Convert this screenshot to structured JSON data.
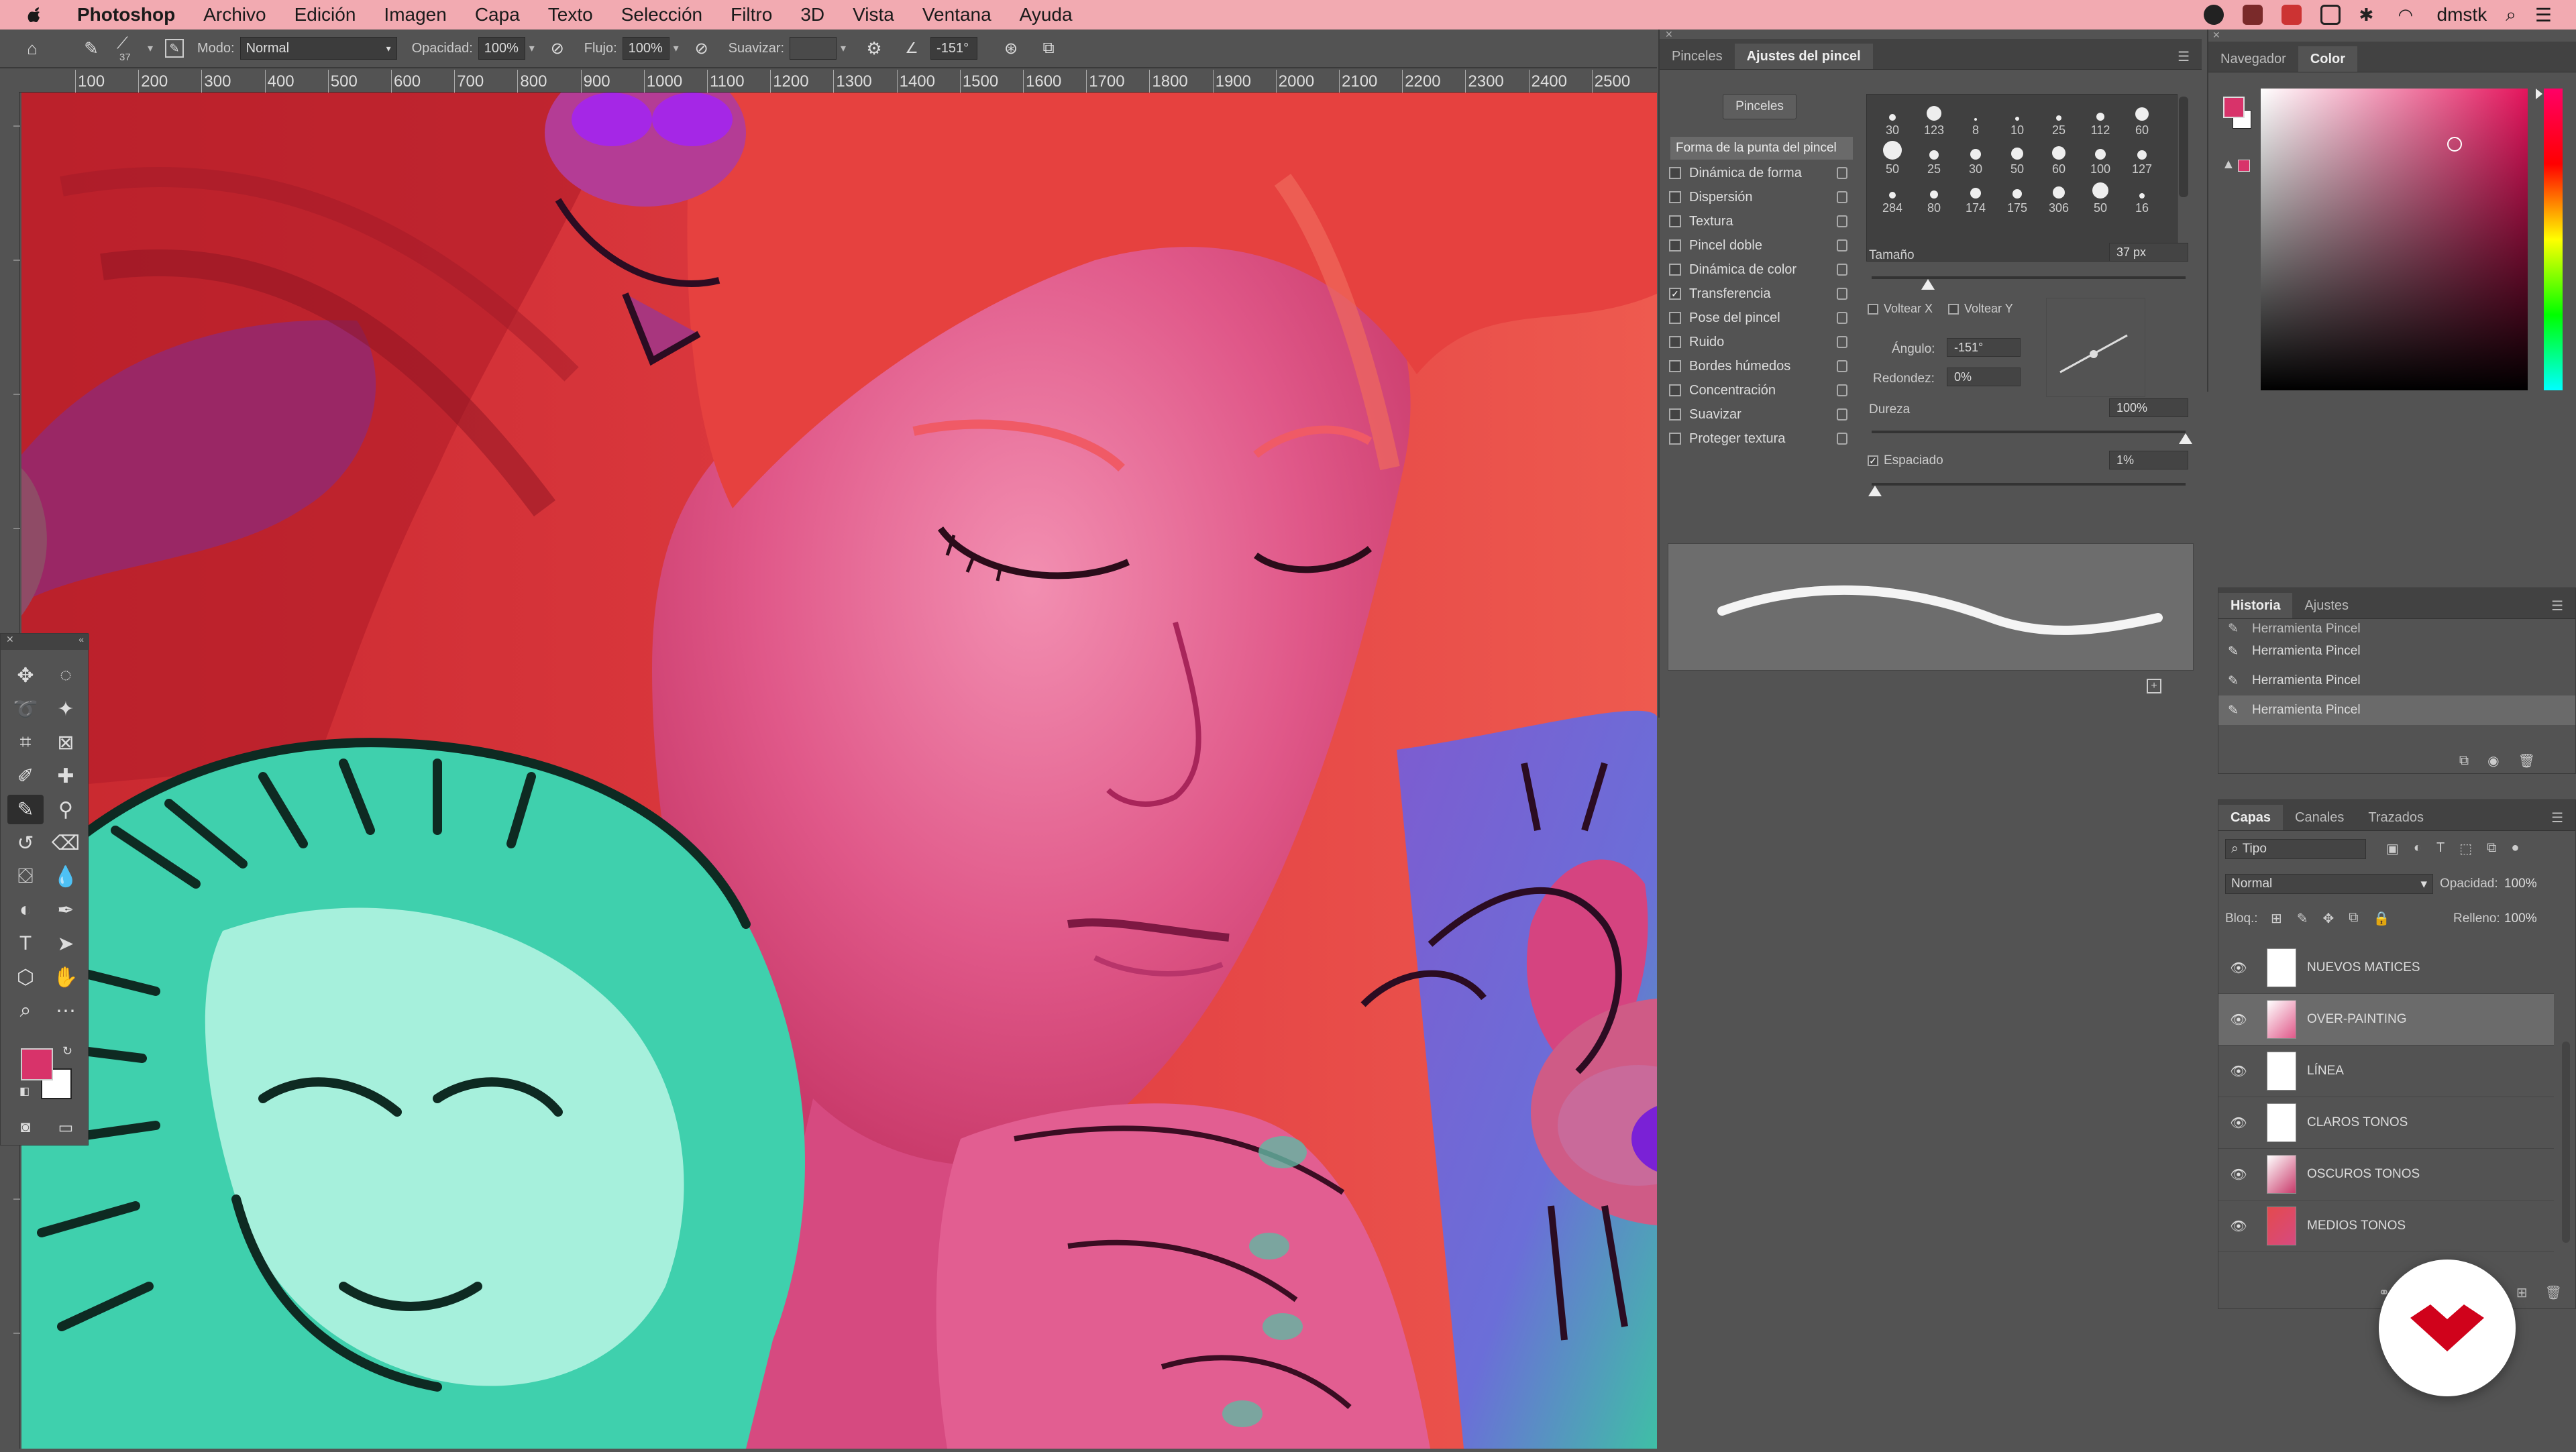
{
  "menubar": {
    "app": "Photoshop",
    "items": [
      "Archivo",
      "Edición",
      "Imagen",
      "Capa",
      "Texto",
      "Selección",
      "Filtro",
      "3D",
      "Vista",
      "Ventana",
      "Ayuda"
    ],
    "user": "dmstk"
  },
  "options": {
    "brush_size": "37",
    "mode_label": "Modo:",
    "mode_value": "Normal",
    "opacity_label": "Opacidad:",
    "opacity_value": "100%",
    "flow_label": "Flujo:",
    "flow_value": "100%",
    "smooth_label": "Suavizar:",
    "angle_value": "-151°"
  },
  "ruler": {
    "top": [
      "100",
      "200",
      "300",
      "400",
      "500",
      "600",
      "700",
      "800",
      "900",
      "1000",
      "1100",
      "1200",
      "1300",
      "1400",
      "1500",
      "1600",
      "1700",
      "1800",
      "1900",
      "2000",
      "2100",
      "2200",
      "2300",
      "2400",
      "2500"
    ]
  },
  "brush_panel": {
    "tabs": [
      "Pinceles",
      "Ajustes del pincel"
    ],
    "active_tab": "Ajustes del pincel",
    "pinceles_button": "Pinceles",
    "tip_shape": "Forma de la punta del pincel",
    "options": [
      {
        "label": "Dinámica de forma",
        "checked": false
      },
      {
        "label": "Dispersión",
        "checked": false
      },
      {
        "label": "Textura",
        "checked": false
      },
      {
        "label": "Pincel doble",
        "checked": false
      },
      {
        "label": "Dinámica de color",
        "checked": false
      },
      {
        "label": "Transferencia",
        "checked": true
      },
      {
        "label": "Pose del pincel",
        "checked": false
      },
      {
        "label": "Ruido",
        "checked": false
      },
      {
        "label": "Bordes húmedos",
        "checked": false
      },
      {
        "label": "Concentración",
        "checked": false
      },
      {
        "label": "Suavizar",
        "checked": false
      },
      {
        "label": "Proteger textura",
        "checked": false
      }
    ],
    "tips": [
      "30",
      "123",
      "8",
      "10",
      "25",
      "112",
      "60",
      "50",
      "25",
      "30",
      "50",
      "60",
      "100",
      "127",
      "284",
      "80",
      "174",
      "175",
      "306",
      "50",
      "16"
    ],
    "size_label": "Tamaño",
    "size_value": "37 px",
    "flip_x": "Voltear X",
    "flip_y": "Voltear Y",
    "angle_label": "Ángulo:",
    "angle_value": "-151°",
    "roundness_label": "Redondez:",
    "roundness_value": "0%",
    "hardness_label": "Dureza",
    "hardness_value": "100%",
    "spacing_label": "Espaciado",
    "spacing_value": "1%",
    "size_level": 0.18,
    "hardness_level": 1.0,
    "spacing_level": 0.01
  },
  "nav_panel": {
    "tabs": [
      "Navegador",
      "Color"
    ],
    "active_tab": "Color",
    "fg_color": "#d8336a"
  },
  "history": {
    "tabs": [
      "Historia",
      "Ajustes"
    ],
    "items": [
      "Herramienta Pincel",
      "Herramienta Pincel",
      "Herramienta Pincel",
      "Herramienta Pincel"
    ]
  },
  "layers": {
    "tabs": [
      "Capas",
      "Canales",
      "Trazados"
    ],
    "filter": "Tipo",
    "blend": "Normal",
    "opacity_label": "Opacidad:",
    "opacity": "100%",
    "lock_label": "Bloq.:",
    "fill_label": "Relleno:",
    "fill": "100%",
    "items": [
      {
        "name": "NUEVOS MATICES",
        "selected": false
      },
      {
        "name": "OVER-PAINTING",
        "selected": true
      },
      {
        "name": "LÍNEA",
        "selected": false
      },
      {
        "name": "CLAROS TONOS",
        "selected": false
      },
      {
        "name": "OSCUROS TONOS",
        "selected": false
      },
      {
        "name": "MEDIOS TONOS",
        "selected": false
      }
    ]
  },
  "colors": {
    "foreground": "#d8336a",
    "background": "#ffffff",
    "logo_red": "#d0021b"
  }
}
